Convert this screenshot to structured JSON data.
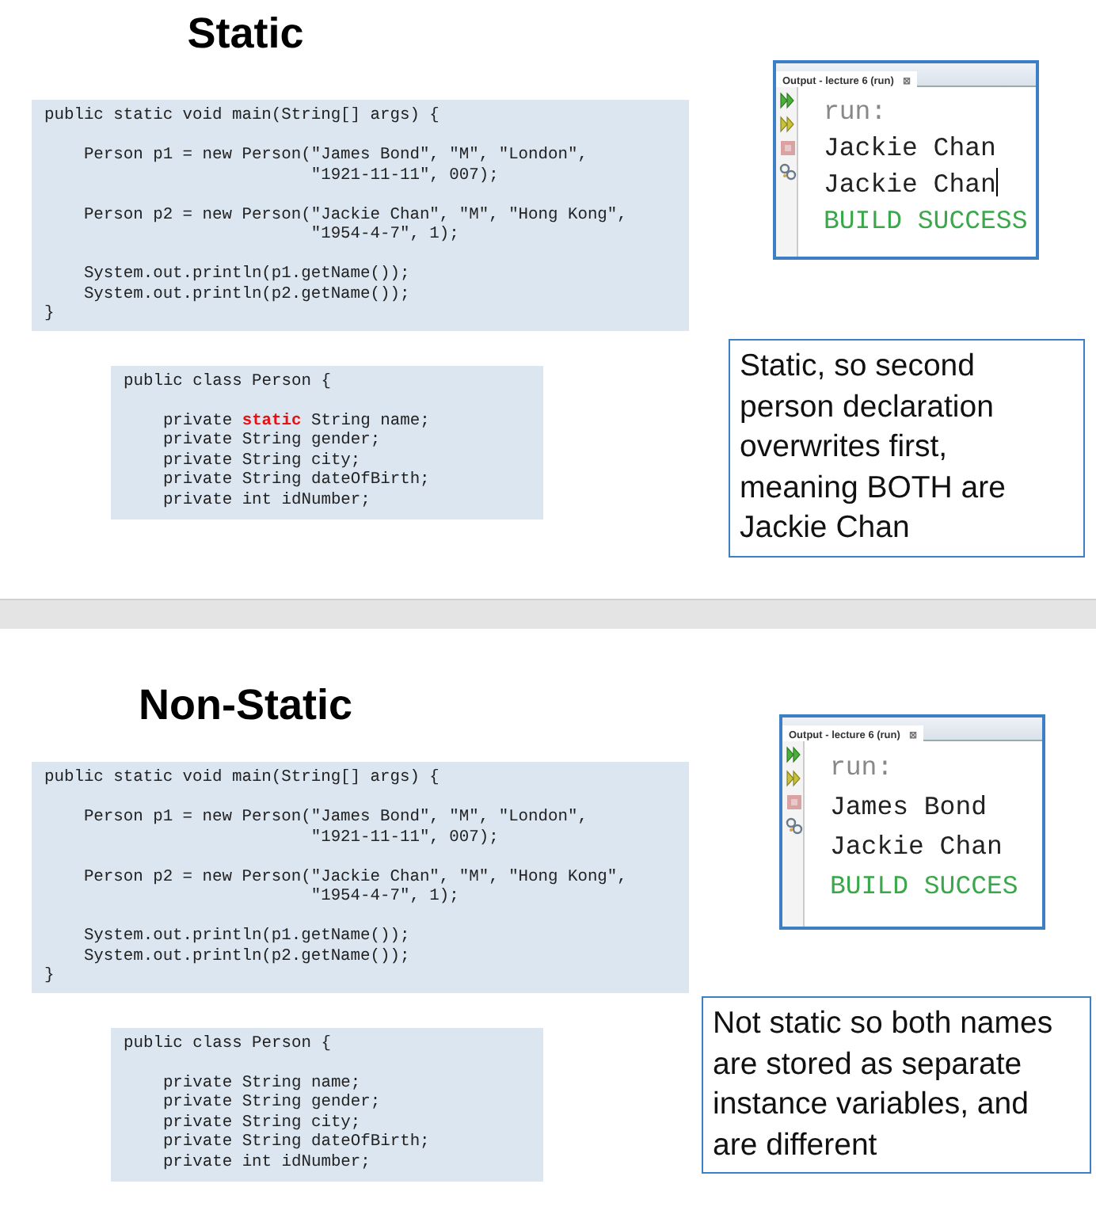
{
  "slides": [
    {
      "title": "Static",
      "main_code": [
        [
          "public static void main(String[] args) {"
        ],
        [
          "    Person p1 = new Person(\"James Bond\", \"M\", \"London\",",
          "                           \"1921-11-11\", 007);"
        ],
        [
          "    Person p2 = new Person(\"Jackie Chan\", \"M\", \"Hong Kong\",",
          "                           \"1954-4-7\", 1);"
        ],
        [
          "    System.out.println(p1.getName());",
          "    System.out.println(p2.getName());",
          "}"
        ]
      ],
      "class_code": [
        [
          [
            {
              "text": "public class Person {",
              "highlight": false
            }
          ]
        ],
        [
          [
            {
              "text": "    private ",
              "highlight": false
            },
            {
              "text": "static",
              "highlight": true
            },
            {
              "text": " String name;",
              "highlight": false
            }
          ],
          [
            {
              "text": "    private String gender;",
              "highlight": false
            }
          ],
          [
            {
              "text": "    private String city;",
              "highlight": false
            }
          ],
          [
            {
              "text": "    private String dateOfBirth;",
              "highlight": false
            }
          ],
          [
            {
              "text": "    private int idNumber;",
              "highlight": false
            }
          ]
        ]
      ],
      "output": {
        "tab": "Output - lecture 6 (run)",
        "close": "⊠",
        "lines": [
          {
            "text": "run:",
            "kind": "prompt",
            "cursor": false
          },
          {
            "text": "Jackie Chan",
            "kind": "output",
            "cursor": false
          },
          {
            "text": "Jackie Chan",
            "kind": "output",
            "cursor": true
          },
          {
            "text": "BUILD SUCCESS",
            "kind": "status",
            "cursor": false
          }
        ]
      },
      "note": "Static, so second person declaration overwrites first, meaning BOTH are Jackie Chan"
    },
    {
      "title": "Non-Static",
      "main_code": [
        [
          "public static void main(String[] args) {"
        ],
        [
          "    Person p1 = new Person(\"James Bond\", \"M\", \"London\",",
          "                           \"1921-11-11\", 007);"
        ],
        [
          "    Person p2 = new Person(\"Jackie Chan\", \"M\", \"Hong Kong\",",
          "                           \"1954-4-7\", 1);"
        ],
        [
          "    System.out.println(p1.getName());",
          "    System.out.println(p2.getName());",
          "}"
        ]
      ],
      "class_code": [
        [
          [
            {
              "text": "public class Person {",
              "highlight": false
            }
          ]
        ],
        [
          [
            {
              "text": "    private String name;",
              "highlight": false
            }
          ],
          [
            {
              "text": "    private String gender;",
              "highlight": false
            }
          ],
          [
            {
              "text": "    private String city;",
              "highlight": false
            }
          ],
          [
            {
              "text": "    private String dateOfBirth;",
              "highlight": false
            }
          ],
          [
            {
              "text": "    private int idNumber;",
              "highlight": false
            }
          ]
        ]
      ],
      "output": {
        "tab": "Output - lecture 6 (run)",
        "close": "⊠",
        "lines": [
          {
            "text": "run:",
            "kind": "prompt",
            "cursor": false
          },
          {
            "text": "James Bond",
            "kind": "output",
            "cursor": false
          },
          {
            "text": "Jackie Chan",
            "kind": "output",
            "cursor": false
          },
          {
            "text": "BUILD SUCCES",
            "kind": "status",
            "cursor": false
          }
        ]
      },
      "note": "Not static so both names are stored as separate instance variables, and are different"
    }
  ]
}
